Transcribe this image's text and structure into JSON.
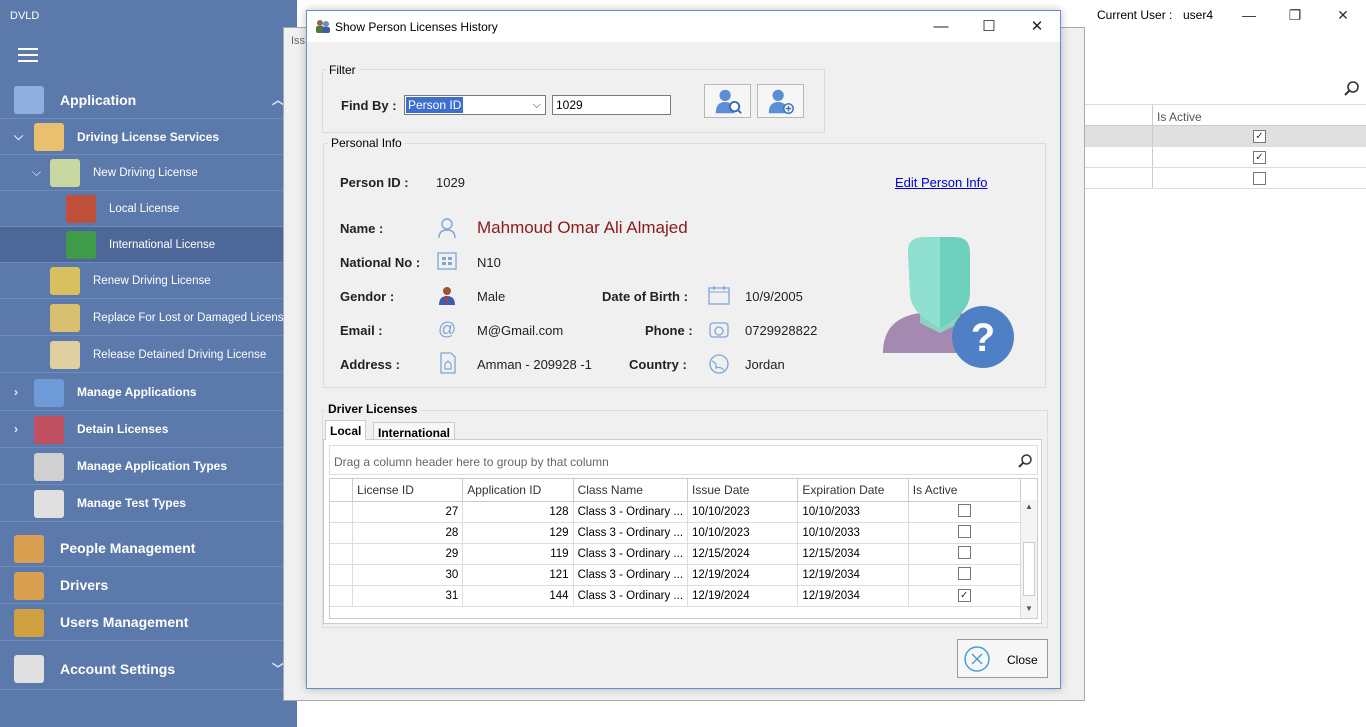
{
  "app": {
    "title": "DVLD"
  },
  "topbar": {
    "current_user_label": "Current User :",
    "current_user_value": "user4",
    "minimize": "—",
    "restore": "❐",
    "close": "✕"
  },
  "sidebar": {
    "items": [
      {
        "label": "Application",
        "level": "top"
      },
      {
        "label": "Driving License Services",
        "level": "sub"
      },
      {
        "label": "New Driving License",
        "level": "sub2"
      },
      {
        "label": "Local License",
        "level": "sub3"
      },
      {
        "label": "International License",
        "level": "sub3"
      },
      {
        "label": "Renew Driving License",
        "level": "sub2"
      },
      {
        "label": "Replace For Lost or Damaged License",
        "level": "sub2"
      },
      {
        "label": "Release Detained Driving License",
        "level": "sub2"
      },
      {
        "label": "Manage Applications",
        "level": "sub"
      },
      {
        "label": "Detain Licenses",
        "level": "sub"
      },
      {
        "label": "Manage Application Types",
        "level": "sub"
      },
      {
        "label": "Manage Test Types",
        "level": "sub"
      },
      {
        "label": "People Management",
        "level": "top"
      },
      {
        "label": "Drivers",
        "level": "top"
      },
      {
        "label": "Users Management",
        "level": "top"
      },
      {
        "label": "Account Settings",
        "level": "top"
      }
    ]
  },
  "background": {
    "dialog_title": "Iss",
    "grid_header": "Is Active",
    "rows": [
      {
        "active": true
      },
      {
        "active": true
      },
      {
        "active": false
      }
    ]
  },
  "dialog": {
    "title": "Show Person Licenses History",
    "filter": {
      "group_label": "Filter",
      "find_by_label": "Find By :",
      "find_by_value": "Person ID",
      "search_value": "1029"
    },
    "person": {
      "group_label": "Personal Info",
      "person_id_label": "Person ID :",
      "person_id": "1029",
      "edit_link": "Edit Person Info",
      "name_label": "Name :",
      "name": "Mahmoud Omar Ali Almajed",
      "national_no_label": "National No :",
      "national_no": "N10",
      "gender_label": "Gendor :",
      "gender": "Male",
      "dob_label": "Date of Birth :",
      "dob": "10/9/2005",
      "email_label": "Email :",
      "email": "M@Gmail.com",
      "phone_label": "Phone :",
      "phone": "0729928822",
      "address_label": "Address :",
      "address": "Amman - 209928 -1",
      "country_label": "Country :",
      "country": "Jordan"
    },
    "licenses": {
      "group_label": "Driver Licenses",
      "tabs": [
        "Local",
        "International"
      ],
      "group_hint": "Drag a column header here to group by that column",
      "columns": [
        "License ID",
        "Application ID",
        "Class Name",
        "Issue Date",
        "Expiration Date",
        "Is Active"
      ],
      "rows": [
        {
          "license_id": "27",
          "application_id": "128",
          "class_name": "Class 3 - Ordinary ...",
          "issue_date": "10/10/2023",
          "expiration_date": "10/10/2033",
          "active": false
        },
        {
          "license_id": "28",
          "application_id": "129",
          "class_name": "Class 3 - Ordinary ...",
          "issue_date": "10/10/2023",
          "expiration_date": "10/10/2033",
          "active": false
        },
        {
          "license_id": "29",
          "application_id": "119",
          "class_name": "Class 3 - Ordinary ...",
          "issue_date": "12/15/2024",
          "expiration_date": "12/15/2034",
          "active": false
        },
        {
          "license_id": "30",
          "application_id": "121",
          "class_name": "Class 3 - Ordinary ...",
          "issue_date": "12/19/2024",
          "expiration_date": "12/19/2034",
          "active": false
        },
        {
          "license_id": "31",
          "application_id": "144",
          "class_name": "Class 3 - Ordinary ...",
          "issue_date": "12/19/2024",
          "expiration_date": "12/19/2034",
          "active": true
        }
      ]
    },
    "close_label": "Close"
  },
  "colors": {
    "sidebar": "#5b79ab",
    "name_text": "#8b1a1a",
    "link": "#0000cc"
  }
}
